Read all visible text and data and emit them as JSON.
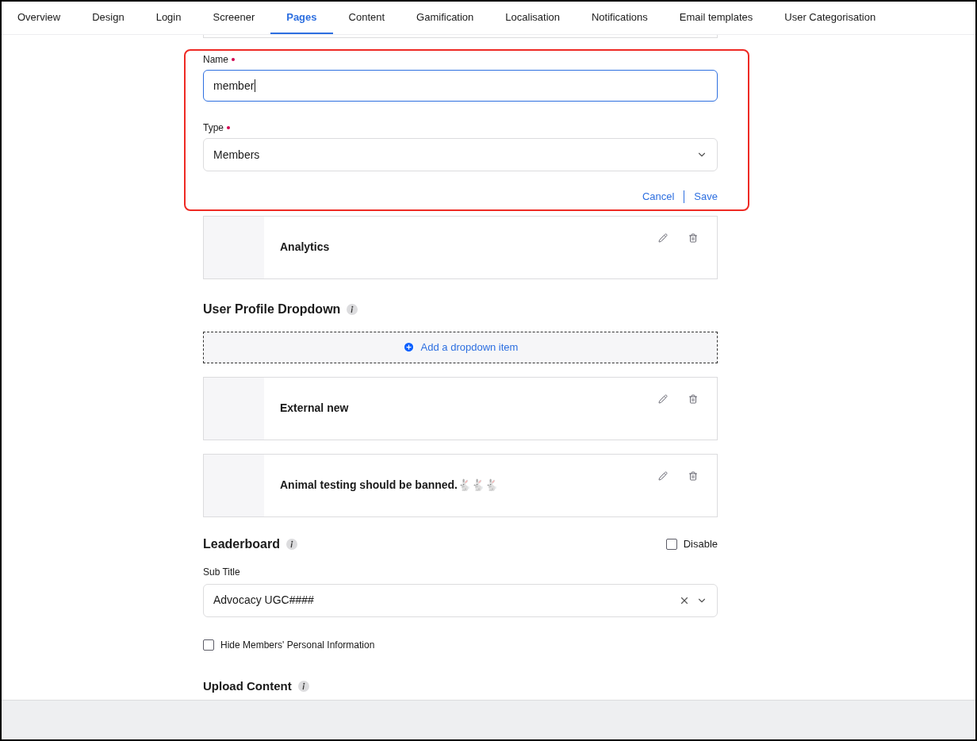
{
  "tabs": [
    {
      "label": "Overview",
      "selected": false
    },
    {
      "label": "Design",
      "selected": false
    },
    {
      "label": "Login",
      "selected": false
    },
    {
      "label": "Screener",
      "selected": false
    },
    {
      "label": "Pages",
      "selected": true
    },
    {
      "label": "Content",
      "selected": false
    },
    {
      "label": "Gamification",
      "selected": false
    },
    {
      "label": "Localisation",
      "selected": false
    },
    {
      "label": "Notifications",
      "selected": false
    },
    {
      "label": "Email templates",
      "selected": false
    },
    {
      "label": "User Categorisation",
      "selected": false
    }
  ],
  "edit_form": {
    "name_label": "Name",
    "name_required": true,
    "name_value": "member",
    "type_label": "Type",
    "type_required": true,
    "type_value": "Members",
    "cancel": "Cancel",
    "save": "Save"
  },
  "pages": [
    {
      "title": "Analytics"
    }
  ],
  "user_profile_dropdown": {
    "title": "User Profile Dropdown",
    "add_button": "Add a dropdown item",
    "items": [
      {
        "title": "External new"
      },
      {
        "title": "Animal testing should be banned.🐇🐇🐇"
      }
    ]
  },
  "leaderboard": {
    "title": "Leaderboard",
    "disable_label": "Disable",
    "disable_checked": false,
    "sub_title_label": "Sub Title",
    "sub_title_value": "Advocacy UGC####",
    "hide_info_label": "Hide Members' Personal Information",
    "hide_info_checked": false
  },
  "upload_content": {
    "title": "Upload Content"
  }
}
